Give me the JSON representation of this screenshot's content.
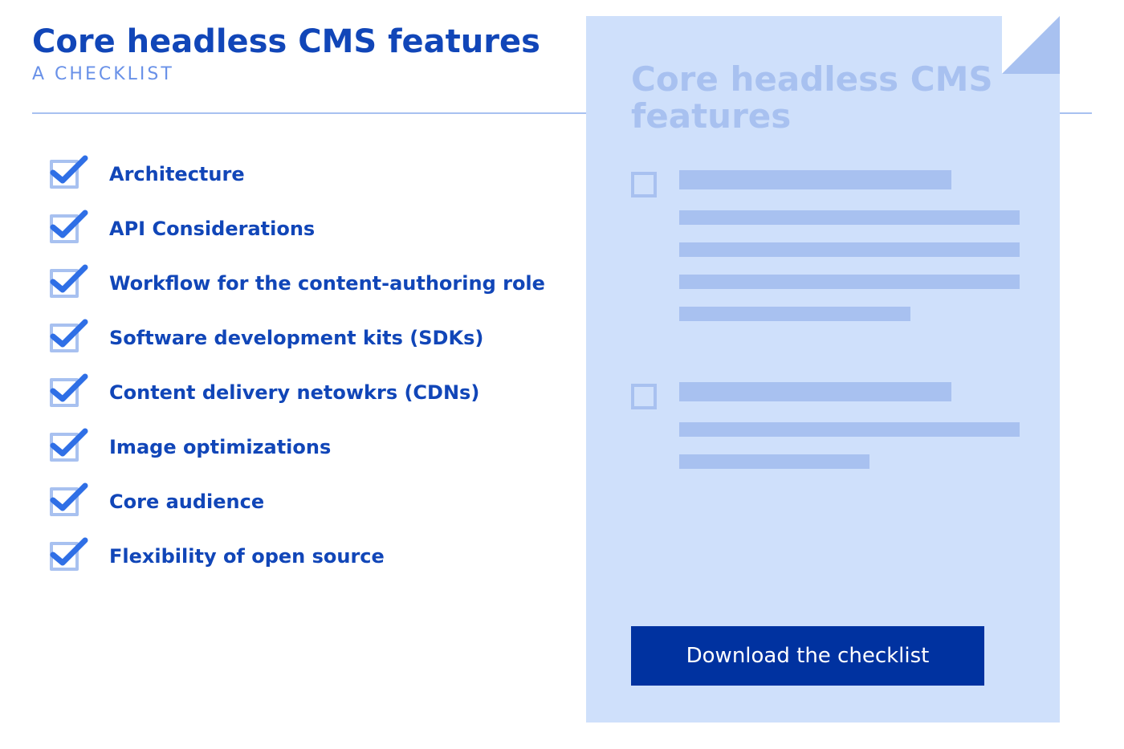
{
  "header": {
    "title": "Core headless CMS features",
    "subtitle": "A CHECKLIST"
  },
  "checklist": {
    "items": [
      {
        "label": "Architecture"
      },
      {
        "label": "API Considerations"
      },
      {
        "label": "Workflow for the content-authoring role"
      },
      {
        "label": "Software development kits (SDKs)"
      },
      {
        "label": "Content delivery netowkrs (CDNs)"
      },
      {
        "label": "Image optimizations"
      },
      {
        "label": "Core audience"
      },
      {
        "label": "Flexibility of open source"
      }
    ]
  },
  "document": {
    "title": "Core headless CMS features",
    "cta_label": "Download the checklist"
  }
}
